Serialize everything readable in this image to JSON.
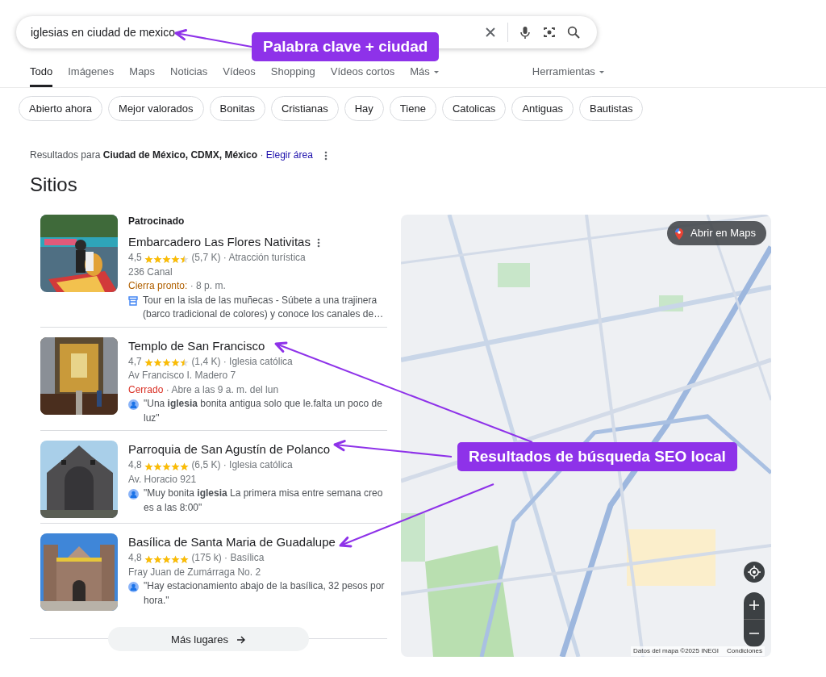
{
  "search": {
    "query": "iglesias en ciudad de mexico"
  },
  "tabs": [
    {
      "label": "Todo",
      "selected": true,
      "kind": "plain"
    },
    {
      "label": "Imágenes",
      "selected": false,
      "kind": "plain"
    },
    {
      "label": "Maps",
      "selected": false,
      "kind": "plain"
    },
    {
      "label": "Noticias",
      "selected": false,
      "kind": "plain"
    },
    {
      "label": "Vídeos",
      "selected": false,
      "kind": "plain"
    },
    {
      "label": "Shopping",
      "selected": false,
      "kind": "plain"
    },
    {
      "label": "Vídeos cortos",
      "selected": false,
      "kind": "plain"
    },
    {
      "label": "Más",
      "selected": false,
      "kind": "menu"
    }
  ],
  "tools": "Herramientas",
  "chips": [
    "Abierto ahora",
    "Mejor valorados",
    "Bonitas",
    "Cristianas",
    "Hay",
    "Tiene",
    "Catolicas",
    "Antiguas",
    "Bautistas"
  ],
  "results_for": {
    "text": "Resultados para **Ciudad de México, CDMX, México** ·",
    "link": "Elegir área"
  },
  "section_title": "Sitios",
  "separator": "·",
  "places": [
    {
      "label": "Patrocinado",
      "name": "Embarcadero Las Flores Nativitas",
      "menu": true,
      "rating": "4,5",
      "stars": 4.5,
      "reviews": "(5,7 K)",
      "category": "Atracción turística",
      "address": "236 Canal",
      "status": {
        "text": "Cierra pronto:",
        "kind": "closing"
      },
      "hours": "8 p. m.",
      "snippet": {
        "kind": "ad",
        "text": "Tour en la isla de las muñecas - Súbete a una trajinera (barco tradicional de colores) y conoce los canales de…"
      }
    },
    {
      "name": "Templo de San Francisco",
      "menu": false,
      "rating": "4,7",
      "stars": 4.5,
      "reviews": "(1,4 K)",
      "category": "Iglesia católica",
      "address": "Av Francisco I. Madero 7",
      "status": {
        "text": "Cerrado",
        "kind": "closed"
      },
      "hours": "Abre a las 9 a. m. del lun",
      "snippet": {
        "kind": "review",
        "text": "\"Una **iglesia** bonita antigua solo que le.falta un poco de luz\""
      }
    },
    {
      "name": "Parroquia de San Agustín de Polanco",
      "menu": false,
      "rating": "4,8",
      "stars": 5,
      "reviews": "(6,5 K)",
      "category": "Iglesia católica",
      "address": "Av. Horacio 921",
      "snippet": {
        "kind": "review",
        "text": "\"Muy bonita **iglesia** La primera misa entre semana creo es a las 8:00\""
      }
    },
    {
      "name": "Basílica de Santa Maria de Guadalupe",
      "menu": false,
      "rating": "4,8",
      "stars": 5,
      "reviews": "(175 k)",
      "category": "Basílica",
      "address": "Fray Juan de Zumárraga No. 2",
      "snippet": {
        "kind": "review",
        "text": "\"Hay estacionamiento abajo de la basílica, 32 pesos por hora.\""
      }
    }
  ],
  "more_button": "Más lugares",
  "map": {
    "open_button": "Abrir en Maps",
    "attribution": "Datos del mapa ©2025 INEGI",
    "terms": "Condiciones"
  },
  "callouts": [
    {
      "text": "Palabra clave + ciudad"
    },
    {
      "text": "Resultados de búsqueda SEO local"
    }
  ]
}
